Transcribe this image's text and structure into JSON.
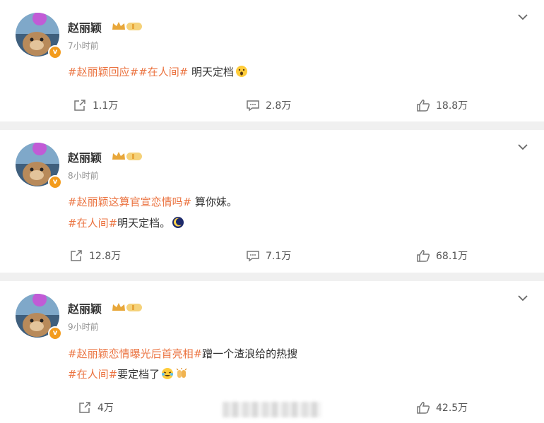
{
  "posts": [
    {
      "username": "赵丽颖",
      "time": "7小时前",
      "lines": [
        [
          {
            "t": "#赵丽颖回应#",
            "tag": true
          },
          {
            "t": "#在人间#",
            "tag": true
          },
          {
            "t": " 明天定档",
            "tag": false
          }
        ]
      ],
      "emojis": [
        "surprised-face-emoji"
      ],
      "shares": "1.1万",
      "comments": "2.8万",
      "likes": "18.8万"
    },
    {
      "username": "赵丽颖",
      "time": "8小时前",
      "lines": [
        [
          {
            "t": "#赵丽颖这算官宣恋情吗#",
            "tag": true
          },
          {
            "t": " 算你妹。",
            "tag": false
          }
        ],
        [
          {
            "t": "#在人间#",
            "tag": true
          },
          {
            "t": "明天定档。",
            "tag": false
          }
        ]
      ],
      "emojis": [
        "moon-emoji"
      ],
      "shares": "12.8万",
      "comments": "7.1万",
      "likes": "68.1万"
    },
    {
      "username": "赵丽颖",
      "time": "9小时前",
      "lines": [
        [
          {
            "t": "#赵丽颖恋情曝光后首亮相#",
            "tag": true
          },
          {
            "t": "蹭一个渣浪给的热搜",
            "tag": false
          }
        ],
        [
          {
            "t": "#在人间#",
            "tag": true
          },
          {
            "t": "要定档了",
            "tag": false
          }
        ]
      ],
      "emojis": [
        "crying-laughing-emoji",
        "clapping-emoji"
      ],
      "shares": "4万",
      "comments": "",
      "likes": "42.5万"
    }
  ],
  "colors": {
    "tag": "#eb7340",
    "verified_badge": "#f39b1c",
    "crown": "#e8a73a",
    "background": "#f0f0f0"
  },
  "icons": {
    "menu": "chevron-down-icon",
    "share": "share-icon",
    "comment": "comment-icon",
    "like": "thumbs-up-icon",
    "member": "crown-icon",
    "verified": "verified-badge-icon"
  }
}
